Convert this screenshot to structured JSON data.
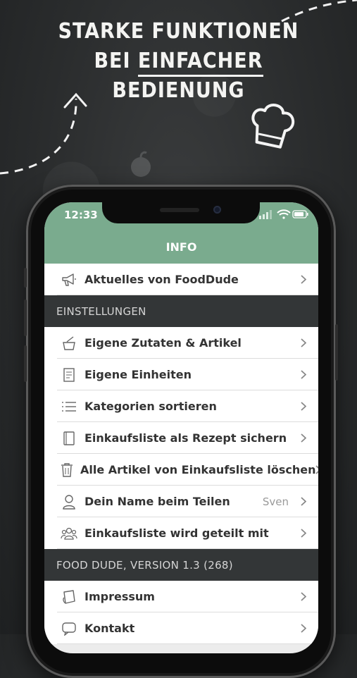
{
  "headline": {
    "line1": "STARKE FUNKTIONEN",
    "line2_prefix": "BEI ",
    "line2_underlined": "EINFACHER",
    "line3": "BEDIENUNG"
  },
  "status_bar": {
    "time": "12:33"
  },
  "nav": {
    "title": "INFO"
  },
  "news_item": {
    "label": "Aktuelles von FoodDude",
    "icon": "megaphone-icon"
  },
  "sections": {
    "settings": "EINSTELLUNGEN",
    "version": "FOOD DUDE, VERSION 1.3 (268)"
  },
  "settings_items": [
    {
      "label": "Eigene Zutaten & Artikel",
      "icon": "pot-icon"
    },
    {
      "label": "Eigene Einheiten",
      "icon": "document-icon"
    },
    {
      "label": "Kategorien sortieren",
      "icon": "list-icon"
    },
    {
      "label": "Einkaufsliste als Rezept sichern",
      "icon": "book-icon"
    },
    {
      "label": "Alle Artikel von Einkaufsliste löschen",
      "icon": "trash-icon"
    },
    {
      "label": "Dein Name beim Teilen",
      "value": "Sven",
      "icon": "person-icon"
    },
    {
      "label": "Einkaufsliste wird geteilt mit",
      "icon": "group-icon"
    }
  ],
  "info_items": [
    {
      "label": "Impressum",
      "icon": "paper-icon"
    },
    {
      "label": "Kontakt",
      "icon": "chat-icon"
    }
  ],
  "colors": {
    "accent": "#7aab8e",
    "section_bg": "#333637",
    "background": "#2a2c2d"
  }
}
